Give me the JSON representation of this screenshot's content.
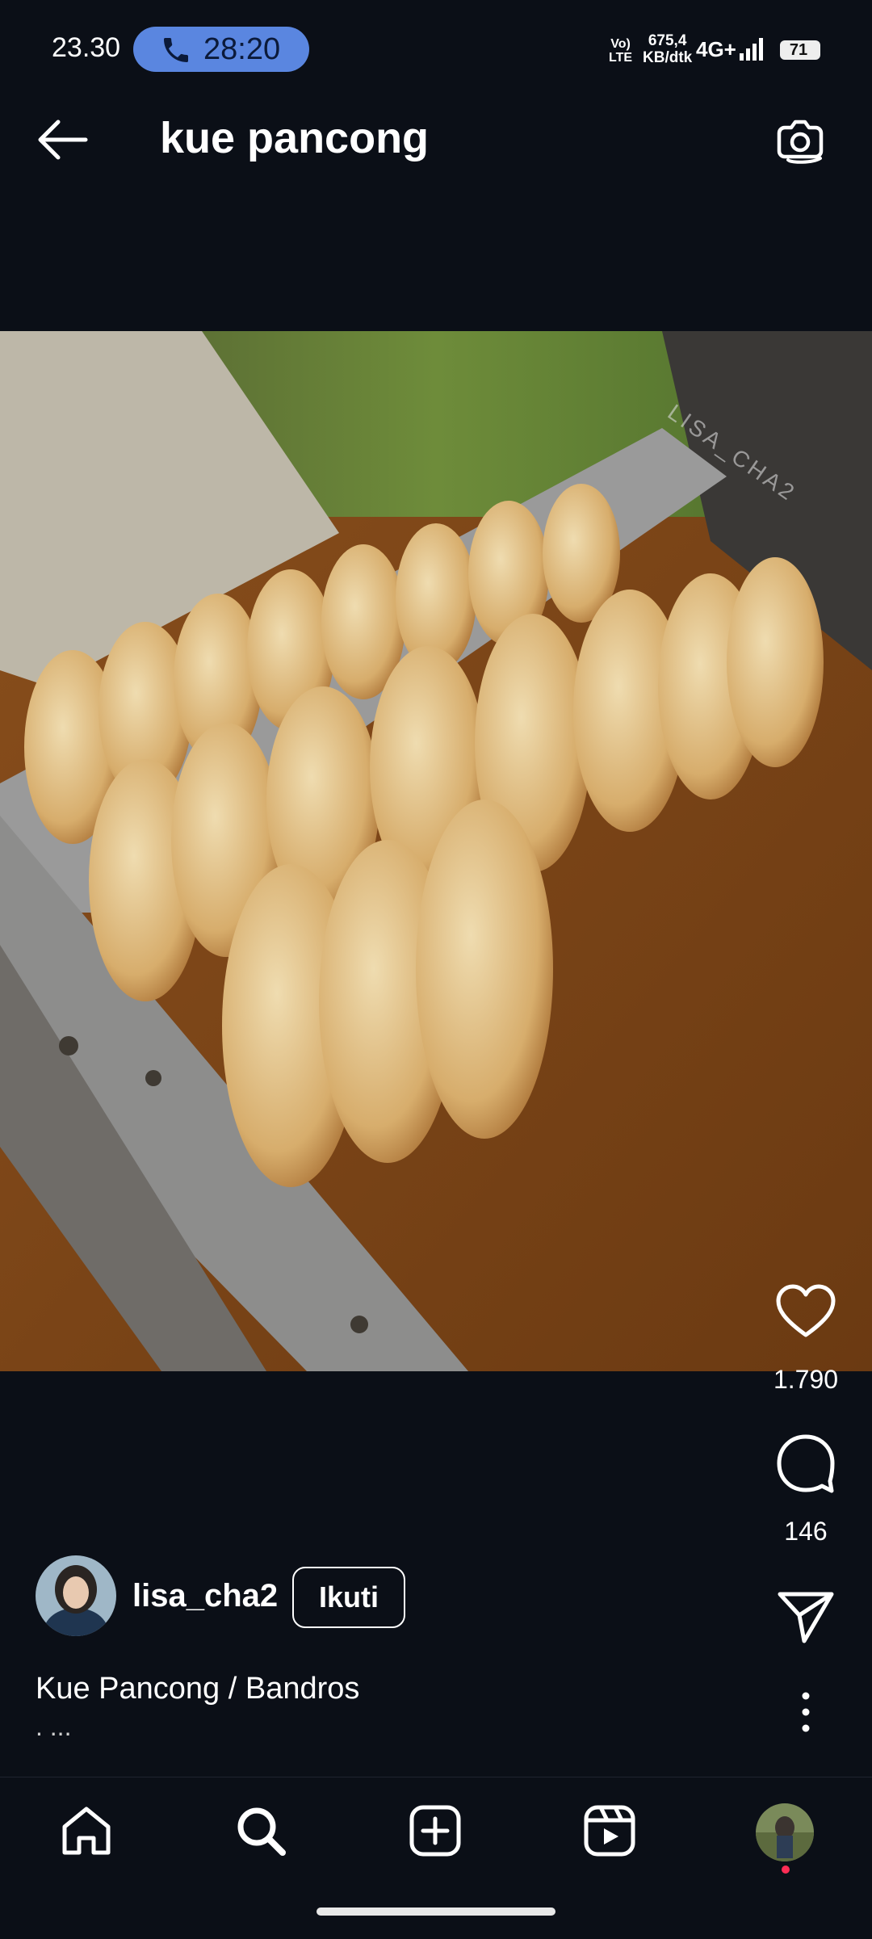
{
  "status_bar": {
    "time": "23.30",
    "call_timer": "28:20",
    "volte": "Vo)\nLTE",
    "net_speed_value": "675,4",
    "net_speed_unit": "KB/dtk",
    "network": "4G+",
    "battery": "71",
    "call_icon": "phone-icon",
    "signal_icon": "signal-icon"
  },
  "header": {
    "title": "kue pancong",
    "back_icon": "arrow-left-icon",
    "camera_icon": "camera-icon"
  },
  "photo": {
    "watermark": "LISA_CHA2"
  },
  "actions": {
    "like_count": "1.790",
    "comment_count": "146",
    "like_icon": "heart-icon",
    "comment_icon": "comment-icon",
    "share_icon": "send-icon",
    "more_icon": "more-vertical-icon"
  },
  "post": {
    "username": "lisa_cha2",
    "follow_label": "Ikuti",
    "caption": "Kue Pancong / Bandros",
    "caption_more": ". ..."
  },
  "bottom_nav": {
    "items": [
      "home-icon",
      "search-icon",
      "add-post-icon",
      "reels-icon",
      "profile-avatar"
    ]
  },
  "colors": {
    "background": "#0b0f17",
    "call_pill": "#5a86e0",
    "notification_dot": "#ff2d55"
  }
}
